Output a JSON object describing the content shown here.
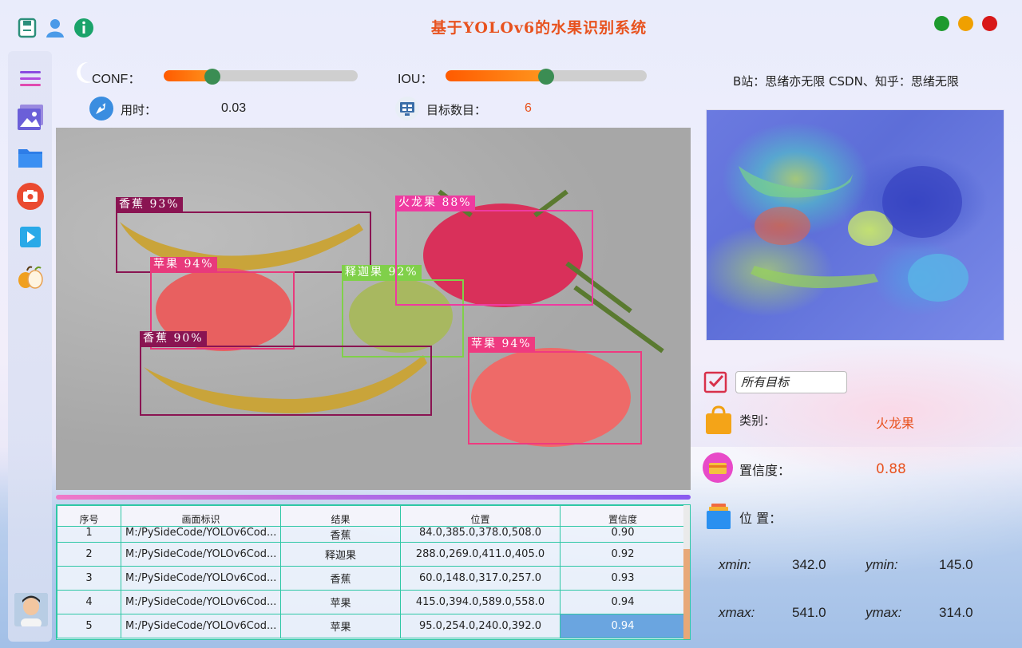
{
  "app": {
    "title": "基于YOLOv6的水果识别系统",
    "credit": "B站：思绪亦无限  CSDN、知乎：思绪无限"
  },
  "controls": {
    "conf_label": "CONF：",
    "conf_value": 0.25,
    "iou_label": "IOU：",
    "iou_value": 0.5,
    "time_label": "用时：",
    "time_value": "0.03",
    "count_label": "目标数目：",
    "count_value": "6"
  },
  "detections": [
    {
      "label": "香蕉 93%",
      "color": "#8a1452"
    },
    {
      "label": "苹果 94%",
      "color": "#e83a7c"
    },
    {
      "label": "释迦果 92%",
      "color": "#80d04a"
    },
    {
      "label": "火龙果 88%",
      "color": "#ef3aa0"
    },
    {
      "label": "香蕉 90%",
      "color": "#8a1452"
    },
    {
      "label": "苹果 94%",
      "color": "#ef3a80"
    }
  ],
  "table": {
    "headers": [
      "序号",
      "画面标识",
      "结果",
      "位置",
      "置信度"
    ],
    "rows": [
      {
        "id": "1",
        "path": "M:/PySideCode/YOLOv6Cod...",
        "result": "香蕉",
        "pos": "84.0,385.0,378.0,508.0",
        "conf": "0.90"
      },
      {
        "id": "2",
        "path": "M:/PySideCode/YOLOv6Cod...",
        "result": "释迦果",
        "pos": "288.0,269.0,411.0,405.0",
        "conf": "0.92"
      },
      {
        "id": "3",
        "path": "M:/PySideCode/YOLOv6Cod...",
        "result": "香蕉",
        "pos": "60.0,148.0,317.0,257.0",
        "conf": "0.93"
      },
      {
        "id": "4",
        "path": "M:/PySideCode/YOLOv6Cod...",
        "result": "苹果",
        "pos": "415.0,394.0,589.0,558.0",
        "conf": "0.94"
      },
      {
        "id": "5",
        "path": "M:/PySideCode/YOLOv6Cod...",
        "result": "苹果",
        "pos": "95.0,254.0,240.0,392.0",
        "conf": "0.94"
      }
    ]
  },
  "result_panel": {
    "target_select": "所有目标",
    "class_label": "类别：",
    "class_value": "火龙果",
    "conf_label": "置信度：",
    "conf_value": "0.88",
    "pos_label": "位  置：",
    "xmin_label": "xmin:",
    "xmin_value": "342.0",
    "ymin_label": "ymin:",
    "ymin_value": "145.0",
    "xmax_label": "xmax:",
    "xmax_value": "541.0",
    "ymax_label": "ymax:",
    "ymax_value": "314.0"
  },
  "colors": {
    "accent": "#e8521e",
    "table_border": "#2ec7a5",
    "selection": "#6aa5e0"
  }
}
